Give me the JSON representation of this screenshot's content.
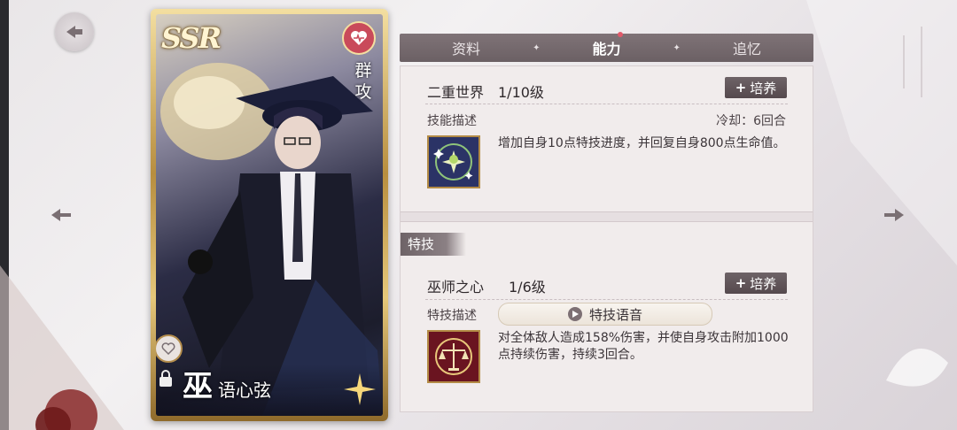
{
  "tabs": [
    {
      "label": "资料",
      "active": false
    },
    {
      "label": "能力",
      "active": true
    },
    {
      "label": "追忆",
      "active": false
    }
  ],
  "card": {
    "rarity": "SSR",
    "type_label": "群攻",
    "title_char": "巫",
    "name": "语心弦",
    "frame_color": "#c9a24f"
  },
  "skill": {
    "name": "二重世界",
    "level": "1/10级",
    "train_label": "培养",
    "desc_label": "技能描述",
    "cooldown": "冷却：6回合",
    "description": "增加自身10点特技进度，并回复自身800点生命值。",
    "icon": "star-moon-icon"
  },
  "special": {
    "section_label": "特技",
    "name": "巫师之心",
    "level": "1/6级",
    "train_label": "培养",
    "desc_label": "特技描述",
    "voice_label": "特技语音",
    "description": "对全体敌人造成158%伤害，并使自身攻击附加1000点持续伤害，持续3回合。",
    "icon": "scales-icon"
  },
  "colors": {
    "tab_bar": "#6b6064",
    "panel_bg": "#f1ecec",
    "button": "#5e5256",
    "accent_red": "#e05a6a"
  }
}
